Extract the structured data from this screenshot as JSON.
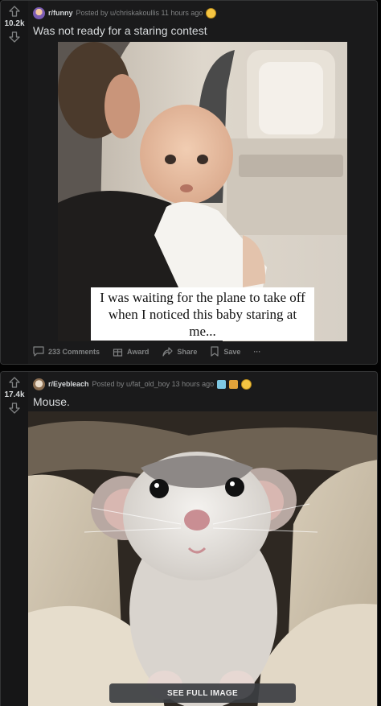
{
  "colors": {
    "background": "#030303",
    "card": "#1a1a1b",
    "border": "#343536",
    "text": "#d7dadc",
    "muted": "#818384"
  },
  "posts": [
    {
      "subreddit": "r/funny",
      "posted_by": "Posted by u/chriskakoullis 11 hours ago",
      "score": "10.2k",
      "title": "Was not ready for a staring contest",
      "image_caption": "I was waiting for the plane to take off when I noticed this baby staring at me...",
      "comments": "233 Comments",
      "award": "Award",
      "share": "Share",
      "save": "Save",
      "more": "···"
    },
    {
      "subreddit": "r/Eyebleach",
      "posted_by": "Posted by u/fat_old_boy 13 hours ago",
      "score": "17.4k",
      "title": "Mouse.",
      "see_full_image": "SEE FULL IMAGE"
    }
  ]
}
